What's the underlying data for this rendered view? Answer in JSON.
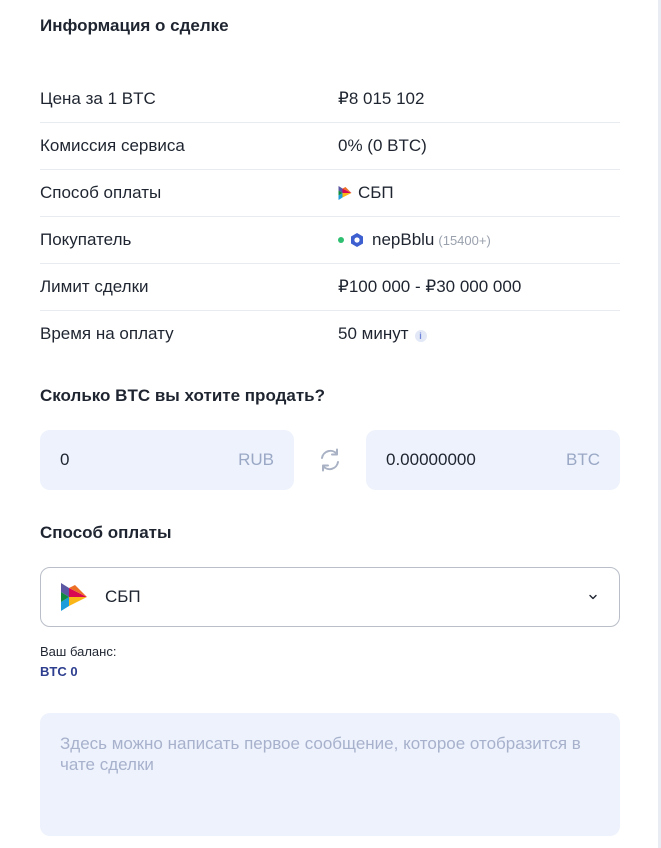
{
  "deal_info": {
    "title": "Информация о сделке",
    "rows": [
      {
        "label": "Цена за 1 BTC",
        "value": "₽8 015 102"
      },
      {
        "label": "Комиссия сервиса",
        "value": "0% (0 BTC)"
      },
      {
        "label": "Способ оплаты",
        "value": "СБП"
      },
      {
        "label": "Покупатель",
        "value": "nepBblu",
        "rating": "(15400+)"
      },
      {
        "label": "Лимит сделки",
        "value": "₽100 000 - ₽30 000 000"
      },
      {
        "label": "Время на оплату",
        "value": "50 минут"
      }
    ]
  },
  "amount": {
    "title": "Сколько BTC вы хотите продать?",
    "rub_value": "0",
    "rub_unit": "RUB",
    "btc_value": "0.00000000",
    "btc_unit": "BTC"
  },
  "payment": {
    "title": "Способ оплаты",
    "selected": "СБП"
  },
  "balance": {
    "label": "Ваш баланс:",
    "value": "BTC 0"
  },
  "message": {
    "placeholder": "Здесь можно написать первое сообщение, которое отобразится в чате сделки"
  },
  "colors": {
    "accent": "#3d5fd0",
    "field_bg": "#edf2fc",
    "online": "#2fbf71"
  }
}
